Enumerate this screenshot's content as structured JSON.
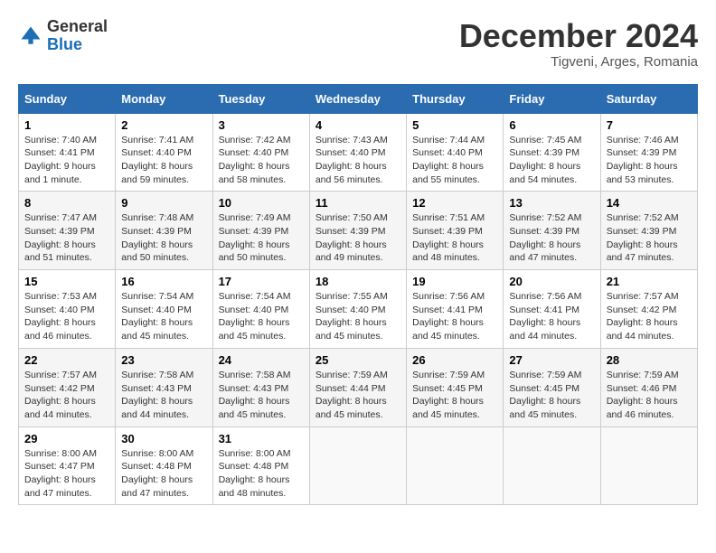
{
  "header": {
    "logo_line1": "General",
    "logo_line2": "Blue",
    "month": "December 2024",
    "location": "Tigveni, Arges, Romania"
  },
  "days_of_week": [
    "Sunday",
    "Monday",
    "Tuesday",
    "Wednesday",
    "Thursday",
    "Friday",
    "Saturday"
  ],
  "weeks": [
    [
      {
        "day": "1",
        "lines": [
          "Sunrise: 7:40 AM",
          "Sunset: 4:41 PM",
          "Daylight: 9 hours",
          "and 1 minute."
        ]
      },
      {
        "day": "2",
        "lines": [
          "Sunrise: 7:41 AM",
          "Sunset: 4:40 PM",
          "Daylight: 8 hours",
          "and 59 minutes."
        ]
      },
      {
        "day": "3",
        "lines": [
          "Sunrise: 7:42 AM",
          "Sunset: 4:40 PM",
          "Daylight: 8 hours",
          "and 58 minutes."
        ]
      },
      {
        "day": "4",
        "lines": [
          "Sunrise: 7:43 AM",
          "Sunset: 4:40 PM",
          "Daylight: 8 hours",
          "and 56 minutes."
        ]
      },
      {
        "day": "5",
        "lines": [
          "Sunrise: 7:44 AM",
          "Sunset: 4:40 PM",
          "Daylight: 8 hours",
          "and 55 minutes."
        ]
      },
      {
        "day": "6",
        "lines": [
          "Sunrise: 7:45 AM",
          "Sunset: 4:39 PM",
          "Daylight: 8 hours",
          "and 54 minutes."
        ]
      },
      {
        "day": "7",
        "lines": [
          "Sunrise: 7:46 AM",
          "Sunset: 4:39 PM",
          "Daylight: 8 hours",
          "and 53 minutes."
        ]
      }
    ],
    [
      {
        "day": "8",
        "lines": [
          "Sunrise: 7:47 AM",
          "Sunset: 4:39 PM",
          "Daylight: 8 hours",
          "and 51 minutes."
        ]
      },
      {
        "day": "9",
        "lines": [
          "Sunrise: 7:48 AM",
          "Sunset: 4:39 PM",
          "Daylight: 8 hours",
          "and 50 minutes."
        ]
      },
      {
        "day": "10",
        "lines": [
          "Sunrise: 7:49 AM",
          "Sunset: 4:39 PM",
          "Daylight: 8 hours",
          "and 50 minutes."
        ]
      },
      {
        "day": "11",
        "lines": [
          "Sunrise: 7:50 AM",
          "Sunset: 4:39 PM",
          "Daylight: 8 hours",
          "and 49 minutes."
        ]
      },
      {
        "day": "12",
        "lines": [
          "Sunrise: 7:51 AM",
          "Sunset: 4:39 PM",
          "Daylight: 8 hours",
          "and 48 minutes."
        ]
      },
      {
        "day": "13",
        "lines": [
          "Sunrise: 7:52 AM",
          "Sunset: 4:39 PM",
          "Daylight: 8 hours",
          "and 47 minutes."
        ]
      },
      {
        "day": "14",
        "lines": [
          "Sunrise: 7:52 AM",
          "Sunset: 4:39 PM",
          "Daylight: 8 hours",
          "and 47 minutes."
        ]
      }
    ],
    [
      {
        "day": "15",
        "lines": [
          "Sunrise: 7:53 AM",
          "Sunset: 4:40 PM",
          "Daylight: 8 hours",
          "and 46 minutes."
        ]
      },
      {
        "day": "16",
        "lines": [
          "Sunrise: 7:54 AM",
          "Sunset: 4:40 PM",
          "Daylight: 8 hours",
          "and 45 minutes."
        ]
      },
      {
        "day": "17",
        "lines": [
          "Sunrise: 7:54 AM",
          "Sunset: 4:40 PM",
          "Daylight: 8 hours",
          "and 45 minutes."
        ]
      },
      {
        "day": "18",
        "lines": [
          "Sunrise: 7:55 AM",
          "Sunset: 4:40 PM",
          "Daylight: 8 hours",
          "and 45 minutes."
        ]
      },
      {
        "day": "19",
        "lines": [
          "Sunrise: 7:56 AM",
          "Sunset: 4:41 PM",
          "Daylight: 8 hours",
          "and 45 minutes."
        ]
      },
      {
        "day": "20",
        "lines": [
          "Sunrise: 7:56 AM",
          "Sunset: 4:41 PM",
          "Daylight: 8 hours",
          "and 44 minutes."
        ]
      },
      {
        "day": "21",
        "lines": [
          "Sunrise: 7:57 AM",
          "Sunset: 4:42 PM",
          "Daylight: 8 hours",
          "and 44 minutes."
        ]
      }
    ],
    [
      {
        "day": "22",
        "lines": [
          "Sunrise: 7:57 AM",
          "Sunset: 4:42 PM",
          "Daylight: 8 hours",
          "and 44 minutes."
        ]
      },
      {
        "day": "23",
        "lines": [
          "Sunrise: 7:58 AM",
          "Sunset: 4:43 PM",
          "Daylight: 8 hours",
          "and 44 minutes."
        ]
      },
      {
        "day": "24",
        "lines": [
          "Sunrise: 7:58 AM",
          "Sunset: 4:43 PM",
          "Daylight: 8 hours",
          "and 45 minutes."
        ]
      },
      {
        "day": "25",
        "lines": [
          "Sunrise: 7:59 AM",
          "Sunset: 4:44 PM",
          "Daylight: 8 hours",
          "and 45 minutes."
        ]
      },
      {
        "day": "26",
        "lines": [
          "Sunrise: 7:59 AM",
          "Sunset: 4:45 PM",
          "Daylight: 8 hours",
          "and 45 minutes."
        ]
      },
      {
        "day": "27",
        "lines": [
          "Sunrise: 7:59 AM",
          "Sunset: 4:45 PM",
          "Daylight: 8 hours",
          "and 45 minutes."
        ]
      },
      {
        "day": "28",
        "lines": [
          "Sunrise: 7:59 AM",
          "Sunset: 4:46 PM",
          "Daylight: 8 hours",
          "and 46 minutes."
        ]
      }
    ],
    [
      {
        "day": "29",
        "lines": [
          "Sunrise: 8:00 AM",
          "Sunset: 4:47 PM",
          "Daylight: 8 hours",
          "and 47 minutes."
        ]
      },
      {
        "day": "30",
        "lines": [
          "Sunrise: 8:00 AM",
          "Sunset: 4:48 PM",
          "Daylight: 8 hours",
          "and 47 minutes."
        ]
      },
      {
        "day": "31",
        "lines": [
          "Sunrise: 8:00 AM",
          "Sunset: 4:48 PM",
          "Daylight: 8 hours",
          "and 48 minutes."
        ]
      },
      {
        "day": "",
        "lines": []
      },
      {
        "day": "",
        "lines": []
      },
      {
        "day": "",
        "lines": []
      },
      {
        "day": "",
        "lines": []
      }
    ]
  ]
}
